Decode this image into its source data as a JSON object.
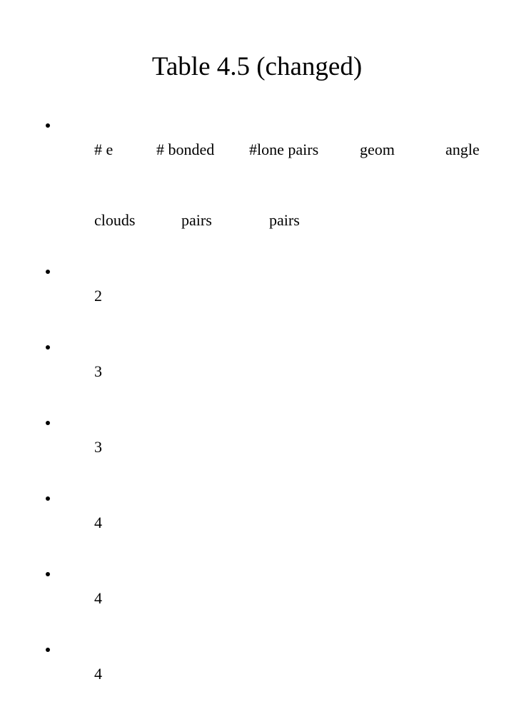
{
  "slide": {
    "title": "Table 4.5 (changed)",
    "background_color": "#ffffff",
    "text_color": "#000000",
    "bullet_glyph": "•"
  },
  "table": {
    "columns": [
      "# e clouds",
      "# bonded pairs",
      "#lone pairs pairs",
      "geom",
      "angle"
    ],
    "header": {
      "line1": {
        "e_clouds": "# e",
        "bonded_pairs": "# bonded",
        "lone_pairs": "#lone pairs",
        "geom": "geom",
        "angle": "angle"
      },
      "line2": {
        "e_clouds": "clouds",
        "bonded_pairs": "pairs",
        "lone_pairs": "pairs",
        "geom": "",
        "angle": ""
      }
    },
    "rows": [
      {
        "e_clouds": "2",
        "bonded_pairs": "",
        "lone_pairs": "",
        "geom": "",
        "angle": ""
      },
      {
        "e_clouds": "3",
        "bonded_pairs": "",
        "lone_pairs": "",
        "geom": "",
        "angle": ""
      },
      {
        "e_clouds": "3",
        "bonded_pairs": "",
        "lone_pairs": "",
        "geom": "",
        "angle": ""
      },
      {
        "e_clouds": "4",
        "bonded_pairs": "",
        "lone_pairs": "",
        "geom": "",
        "angle": ""
      },
      {
        "e_clouds": "4",
        "bonded_pairs": "",
        "lone_pairs": "",
        "geom": "",
        "angle": ""
      },
      {
        "e_clouds": "4",
        "bonded_pairs": "",
        "lone_pairs": "",
        "geom": "",
        "angle": ""
      }
    ]
  }
}
